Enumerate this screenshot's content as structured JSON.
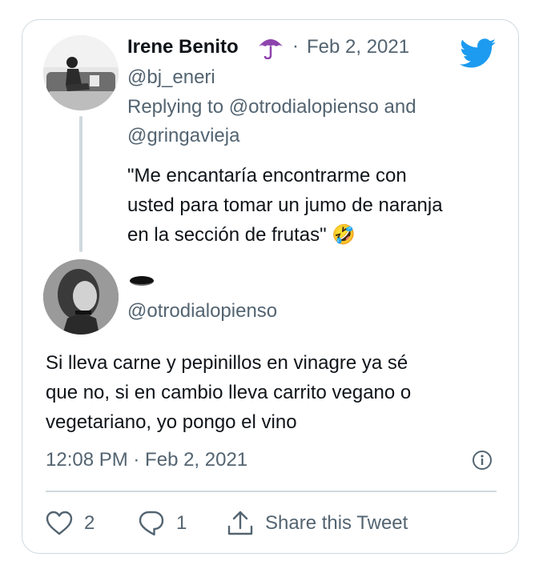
{
  "header": {
    "name": "Irene Benito",
    "name_emoji": "☂",
    "separator": "·",
    "date": "Feb 2, 2021",
    "handle": "@bj_eneri",
    "replying_line1": "Replying to @otrodialopienso and",
    "replying_line2": "@gringavieja"
  },
  "quoted_text": {
    "line1": "\"Me encantaría encontrarme con",
    "line2": "usted para tomar un jumo de naranja",
    "line3": "en la sección de frutas\"",
    "emoji": "🤣"
  },
  "reply_author": {
    "handle": "@otrodialopienso"
  },
  "main_text": {
    "line1": "Si lleva carne y pepinillos en vinagre ya sé",
    "line2": "que no, si en cambio lleva carrito vegano o",
    "line3": "vegetariano, yo pongo el vino"
  },
  "timestamp": "12:08 PM · Feb 2, 2021",
  "actions": {
    "like_count": "2",
    "reply_count": "1",
    "share_label": "Share this Tweet"
  },
  "colors": {
    "brand": "#1d9bf0",
    "secondary_text": "#536471",
    "border": "#cfd9de"
  },
  "icons": [
    "twitter-bird-icon",
    "umbrella-icon",
    "info-icon",
    "heart-icon",
    "reply-bubble-icon",
    "share-icon"
  ]
}
